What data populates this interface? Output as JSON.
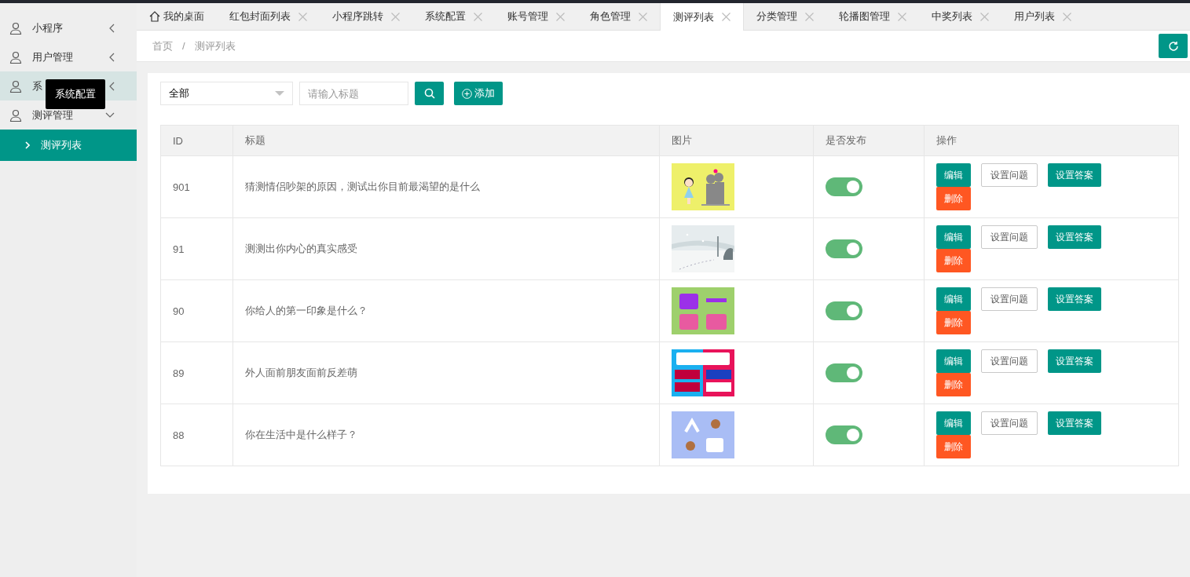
{
  "sidebar": {
    "items": [
      {
        "label": "小程序",
        "expanded": false,
        "hovered": false
      },
      {
        "label": "用户管理",
        "expanded": false,
        "hovered": false
      },
      {
        "label": "系",
        "expanded": false,
        "hovered": true
      },
      {
        "label": "测评管理",
        "expanded": true,
        "hovered": false,
        "children": [
          {
            "label": "测评列表",
            "selected": true
          }
        ]
      }
    ],
    "tooltip": "系统配置"
  },
  "tabs": [
    {
      "label": "我的桌面",
      "kind": "home",
      "selected": false
    },
    {
      "label": "红包封面列表",
      "kind": "closable",
      "selected": false
    },
    {
      "label": "小程序跳转",
      "kind": "closable",
      "selected": false
    },
    {
      "label": "系统配置",
      "kind": "closable",
      "selected": false
    },
    {
      "label": "账号管理",
      "kind": "closable",
      "selected": false
    },
    {
      "label": "角色管理",
      "kind": "closable",
      "selected": false
    },
    {
      "label": "测评列表",
      "kind": "closable",
      "selected": true
    },
    {
      "label": "分类管理",
      "kind": "closable",
      "selected": false
    },
    {
      "label": "轮播图管理",
      "kind": "closable",
      "selected": false
    },
    {
      "label": "中奖列表",
      "kind": "closable",
      "selected": false
    },
    {
      "label": "用户列表",
      "kind": "closable",
      "selected": false
    }
  ],
  "breadcrumb": {
    "items": [
      "首页",
      "测评列表"
    ],
    "separator": "/"
  },
  "filter": {
    "select_value": "全部",
    "search_placeholder": "请输入标题",
    "add_button": "添加"
  },
  "table": {
    "columns": [
      "ID",
      "标题",
      "图片",
      "是否发布",
      "操作"
    ],
    "rows": [
      {
        "id": "901",
        "title": "猜测情侣吵架的原因，测试出你目前最渴望的是什么",
        "image": {
          "kind": "picture"
        },
        "published": true,
        "actions": [
          "编辑",
          "设置问题",
          "设置答案",
          "删除"
        ]
      },
      {
        "id": "91",
        "title": "测测出你内心的真实感受",
        "image": {
          "kind": "picture"
        },
        "published": true,
        "actions": [
          "编辑",
          "设置问题",
          "设置答案",
          "删除"
        ]
      },
      {
        "id": "90",
        "title": "你给人的第一印象是什么？",
        "image": {
          "kind": "picture"
        },
        "published": true,
        "actions": [
          "编辑",
          "设置问题",
          "设置答案",
          "删除"
        ]
      },
      {
        "id": "89",
        "title": "外人面前朋友面前反差萌",
        "image": {
          "kind": "picture"
        },
        "published": true,
        "actions": [
          "编辑",
          "设置问题",
          "设置答案",
          "删除"
        ]
      },
      {
        "id": "88",
        "title": "你在生活中是什么样子？",
        "image": {
          "kind": "picture"
        },
        "published": true,
        "actions": [
          "编辑",
          "设置问题",
          "设置答案",
          "删除"
        ]
      }
    ]
  }
}
